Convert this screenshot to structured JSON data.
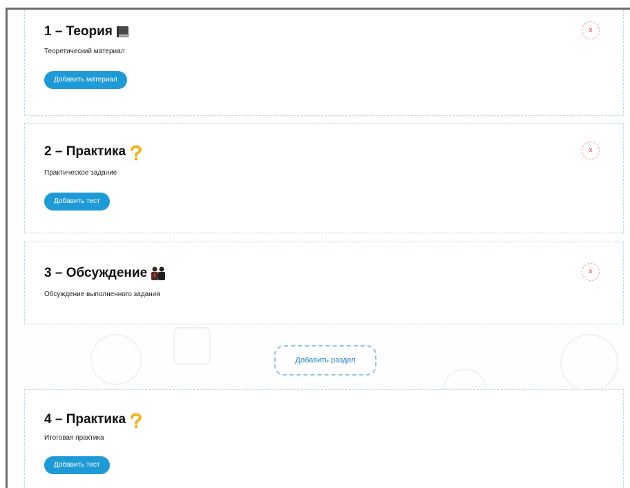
{
  "sections": [
    {
      "title": "1 – Теория",
      "description": "Теоретический материал",
      "button_label": "Добавить материал",
      "icon": "book-icon",
      "close_label": "x"
    },
    {
      "title": "2 – Практика",
      "description": "Практическое задание",
      "button_label": "Добавить тест",
      "icon": "question-icon",
      "close_label": "x"
    },
    {
      "title": "3 – Обсуждение",
      "description": "Обсуждение выполненного задания",
      "icon": "people-icon",
      "close_label": "x"
    },
    {
      "title": "4 – Практика",
      "description": "Итоговая практика",
      "button_label": "Добавить тест",
      "icon": "question-icon"
    }
  ],
  "add_section_label": "Добавить раздел",
  "colors": {
    "button": "#1e9ad6",
    "dashed_border": "#b9d9ea",
    "close": "#f09a9a",
    "add_section_border": "#8cc3e3"
  }
}
